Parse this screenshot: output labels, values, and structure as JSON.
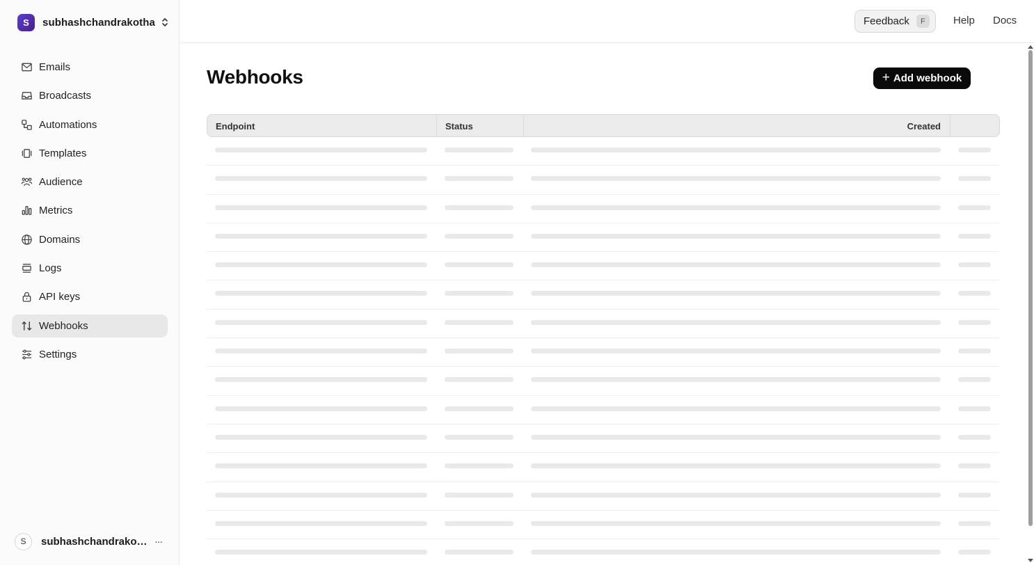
{
  "team": {
    "initial": "S",
    "name": "subhashchandrakotha"
  },
  "nav": {
    "items": [
      {
        "label": "Emails",
        "icon": "mail-icon",
        "active": false
      },
      {
        "label": "Broadcasts",
        "icon": "inbox-icon",
        "active": false
      },
      {
        "label": "Automations",
        "icon": "workflow-icon",
        "active": false
      },
      {
        "label": "Templates",
        "icon": "template-icon",
        "active": false
      },
      {
        "label": "Audience",
        "icon": "users-icon",
        "active": false
      },
      {
        "label": "Metrics",
        "icon": "bar-chart-icon",
        "active": false
      },
      {
        "label": "Domains",
        "icon": "globe-icon",
        "active": false
      },
      {
        "label": "Logs",
        "icon": "logs-icon",
        "active": false
      },
      {
        "label": "API keys",
        "icon": "lock-icon",
        "active": false
      },
      {
        "label": "Webhooks",
        "icon": "arrows-up-down-icon",
        "active": true
      },
      {
        "label": "Settings",
        "icon": "sliders-icon",
        "active": false
      }
    ]
  },
  "user": {
    "initial": "S",
    "name": "subhashchandrakotha",
    "more": "···"
  },
  "topbar": {
    "feedback": "Feedback",
    "feedback_key": "F",
    "help": "Help",
    "docs": "Docs"
  },
  "page": {
    "title": "Webhooks",
    "add_button": "Add webhook",
    "add_icon": "+"
  },
  "table": {
    "columns": [
      "Endpoint",
      "Status",
      "Created"
    ],
    "loading_rows": 15
  }
}
